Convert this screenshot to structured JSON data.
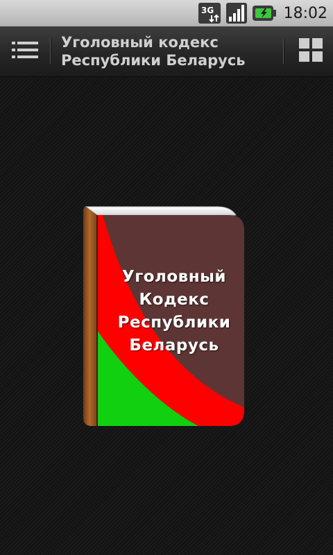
{
  "status_bar": {
    "time": "18:02",
    "network_label": "3G",
    "network_icon": "3g-data-icon",
    "signal_icon": "signal-strength-icon",
    "battery_icon": "battery-charging-icon"
  },
  "action_bar": {
    "title_line1": "Уголовный кодекс",
    "title_line2": "Республики Беларусь",
    "menu_icon": "list-menu-icon",
    "grid_icon": "grid-view-icon"
  },
  "book": {
    "title_lines": [
      "Уголовный",
      "Кодекс",
      "Республики",
      "Беларусь"
    ],
    "colors": {
      "cover": "#5e3535",
      "red": "#ff0000",
      "green": "#10d010",
      "spine": "#a05a28"
    }
  }
}
